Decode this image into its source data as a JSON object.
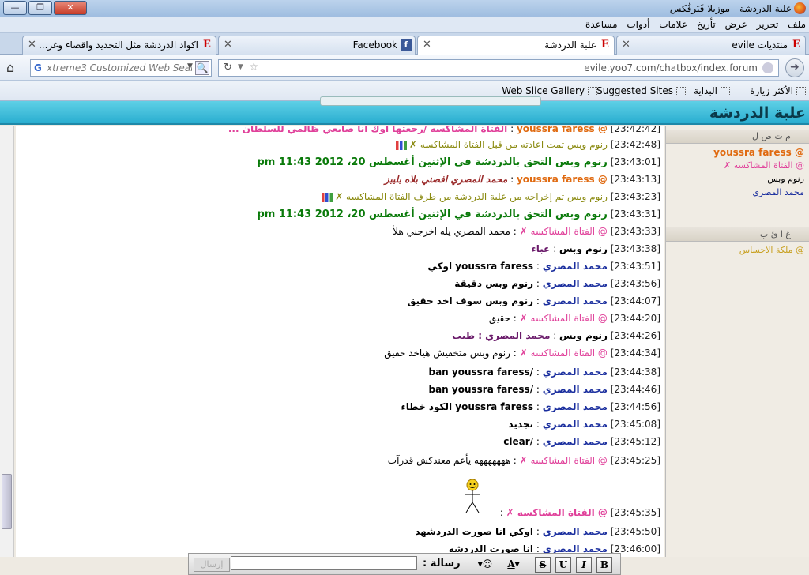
{
  "window": {
    "title": "علبة الدردشة - موزيلا فَيَرفُكس"
  },
  "menu": [
    "ملف",
    "تحرير",
    "عرض",
    "تأريخ",
    "علامات",
    "أدوات",
    "مساعدة"
  ],
  "tabs": [
    {
      "label": "منتديات evile",
      "icon": "E"
    },
    {
      "label": "علبة الدردشة",
      "icon": "E",
      "active": true
    },
    {
      "label": "Facebook",
      "icon": "f"
    },
    {
      "label": "اكواد الدردشة مثل التجديد واقصاء وغر...",
      "icon": "E"
    }
  ],
  "nav": {
    "search_placeholder": "xtreme3 Customized Web Search",
    "url": "evile.yoo7.com/chatbox/index.forum"
  },
  "bookmarks": [
    "الأكثر زيارة",
    "البداية",
    "Suggested Sites",
    "Web Slice Gallery"
  ],
  "header": {
    "title": "علبة الدردشة"
  },
  "messages": [
    {
      "ts": "[23:42:42]",
      "who": "@ youssra faress",
      "sep": " : ",
      "txt": "الفتاة المشاكسه /رجعتها اوك انا ضايعي ظالمي للسلطان ...",
      "cls": "c-pink",
      "wcls": "c-orange"
    },
    {
      "ts": "[23:42:48]",
      "who": "",
      "sep": "",
      "txt": "رنوم وبس تمت اعادته من قبل الفتاة المشاكسه ✗",
      "cls": "c-olive",
      "wcls": "c-olive",
      "icon": "chart"
    },
    {
      "ts": "[23:43:01]",
      "who": "",
      "sep": "",
      "txt": "رنوم وبس التحق بالدردشة في الإثنين أغسطس 20، 2012 11:43 pm",
      "cls": "c-green",
      "wcls": "c-green"
    },
    {
      "ts": "[23:43:13]",
      "who": "@ youssra faress",
      "sep": " : ",
      "txt": "محمد المصري افصني بلاه بليبز",
      "cls": "c-brown",
      "wcls": "c-orange"
    },
    {
      "ts": "[23:43:23]",
      "who": "",
      "sep": "",
      "txt": "رنوم وبس تم إخراجه من علبة الدردشة من طرف الفتاة المشاكسه ✗",
      "cls": "c-olive",
      "wcls": "c-olive",
      "icon": "chart"
    },
    {
      "ts": "[23:43:31]",
      "who": "",
      "sep": "",
      "txt": "رنوم وبس التحق بالدردشة في الإثنين أغسطس 20، 2012 11:43 pm",
      "cls": "c-green",
      "wcls": "c-green"
    },
    {
      "ts": "[23:43:33]",
      "who": "@ الفتاة المشاكسه ✗",
      "sep": " : ",
      "txt": "محمد المصري يله اخرجني هلأ",
      "cls": "c-black",
      "wcls": "c-pink",
      "normal": true
    },
    {
      "ts": "[23:43:38]",
      "who": "رنوم وبس",
      "sep": " : ",
      "txt": "غباء",
      "cls": "c-purple",
      "wcls": "c-black"
    },
    {
      "ts": "[23:43:51]",
      "who": "محمد المصري",
      "sep": " : ",
      "txt": "youssra faress اوكي",
      "cls": "c-black",
      "wcls": "c-blue"
    },
    {
      "ts": "[23:43:56]",
      "who": "محمد المصري",
      "sep": " : ",
      "txt": "رنوم وبس دقيقة",
      "cls": "c-black",
      "wcls": "c-blue"
    },
    {
      "ts": "[23:44:07]",
      "who": "محمد المصري",
      "sep": " : ",
      "txt": "رنوم وبس سوف اخذ حقيق",
      "cls": "c-black",
      "wcls": "c-blue"
    },
    {
      "ts": "[23:44:20]",
      "who": "@ الفتاة المشاكسه ✗",
      "sep": " : ",
      "txt": "حقيق",
      "cls": "c-black",
      "wcls": "c-pink",
      "normal": true
    },
    {
      "ts": "[23:44:26]",
      "who": "رنوم وبس",
      "sep": " : ",
      "txt": "محمد المصري : طيب",
      "cls": "c-purple",
      "wcls": "c-black"
    },
    {
      "ts": "[23:44:34]",
      "who": "@ الفتاة المشاكسه ✗",
      "sep": " : ",
      "txt": "رنوم وبس متخفيش هياخد حقيق",
      "cls": "c-black",
      "wcls": "c-pink",
      "normal": true
    },
    {
      "ts": "[23:44:38]",
      "who": "محمد المصري",
      "sep": " : ",
      "txt": "/ban youssra faress",
      "cls": "c-black",
      "wcls": "c-blue"
    },
    {
      "ts": "[23:44:46]",
      "who": "محمد المصري",
      "sep": " : ",
      "txt": "/ban youssra faress",
      "cls": "c-black",
      "wcls": "c-blue"
    },
    {
      "ts": "[23:44:56]",
      "who": "محمد المصري",
      "sep": " : ",
      "txt": "youssra faress الكود خطاء",
      "cls": "c-black",
      "wcls": "c-blue"
    },
    {
      "ts": "[23:45:08]",
      "who": "محمد المصري",
      "sep": " : ",
      "txt": "تجديد",
      "cls": "c-black",
      "wcls": "c-blue"
    },
    {
      "ts": "[23:45:12]",
      "who": "محمد المصري",
      "sep": " : ",
      "txt": "/clear",
      "cls": "c-black",
      "wcls": "c-blue"
    },
    {
      "ts": "[23:45:25]",
      "who": "@ الفتاة المشاكسه ✗",
      "sep": " : ",
      "txt": "هههههههه يأعم معندكش قدرآت",
      "cls": "c-black",
      "wcls": "c-pink",
      "normal": true
    },
    {
      "ts": "[23:45:35]",
      "who": "@ الفتاة المشاكسه ✗",
      "sep": " : ",
      "txt": "",
      "cls": "c-black",
      "wcls": "c-pink"
    },
    {
      "ts": "[23:45:50]",
      "who": "محمد المصري",
      "sep": " : ",
      "txt": "اوكي انا صورت الدردشهد",
      "cls": "c-black",
      "wcls": "c-blue"
    },
    {
      "ts": "[23:46:00]",
      "who": "محمد المصري",
      "sep": " : ",
      "txt": "انا صورت الدردشه",
      "cls": "c-black",
      "wcls": "c-blue"
    }
  ],
  "panel": {
    "online_head": "م ت ص ل",
    "online_users": [
      {
        "name": "@ youssra faress",
        "color": "#e06a10"
      },
      {
        "name": "@ الفتاة المشاكسه ✗",
        "color": "#e0409a"
      },
      {
        "name": "رنوم وبس",
        "color": "#000000"
      },
      {
        "name": "محمد المصري",
        "color": "#1a2e9e"
      }
    ],
    "away_head": "غ ا ئ ب",
    "away_users": [
      {
        "name": "@ ملكة الاحساس",
        "color": "#c8a020"
      }
    ]
  },
  "msgbar": {
    "label": "رسالة :",
    "send_label": "إرسال",
    "input_value": ""
  }
}
